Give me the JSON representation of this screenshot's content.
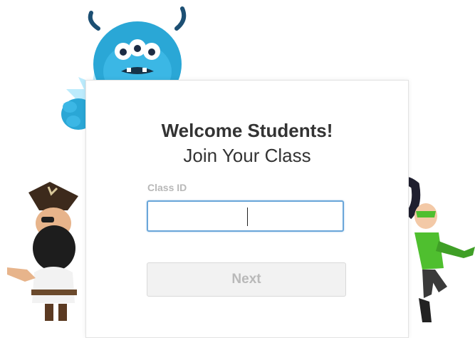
{
  "card": {
    "title": "Welcome Students!",
    "subtitle": "Join Your Class",
    "class_id_label": "Class ID",
    "class_id_value": "",
    "class_id_placeholder": "",
    "next_label": "Next"
  },
  "illustrations": {
    "monster": "blue-monster-illustration",
    "pirate": "pirate-illustration",
    "hero": "green-hero-illustration"
  },
  "colors": {
    "monster_blue": "#2aa7d6",
    "hero_green": "#4fbf2f",
    "focus_border": "#6aa6d9",
    "button_bg": "#f2f2f2"
  }
}
